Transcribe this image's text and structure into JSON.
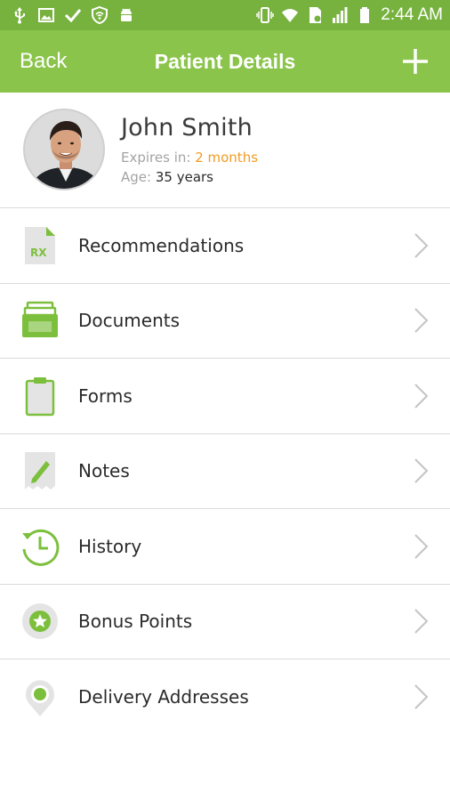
{
  "status_bar": {
    "time": "2:44 AM",
    "icons_left": [
      "usb-icon",
      "image-icon",
      "check-icon",
      "shield-wifi-icon",
      "android-icon"
    ],
    "icons_right": [
      "vibrate-icon",
      "wifi-icon",
      "sim-icon",
      "signal-icon",
      "battery-icon"
    ]
  },
  "appbar": {
    "back_label": "Back",
    "title": "Patient Details",
    "add_icon": "plus-icon"
  },
  "patient": {
    "name": "John Smith",
    "expires_label": "Expires in:",
    "expires_value": "2 months",
    "age_label": "Age:",
    "age_value": "35 years"
  },
  "menu": [
    {
      "label": "Recommendations",
      "icon": "rx-document-icon"
    },
    {
      "label": "Documents",
      "icon": "documents-stack-icon"
    },
    {
      "label": "Forms",
      "icon": "clipboard-icon"
    },
    {
      "label": "Notes",
      "icon": "pencil-note-icon"
    },
    {
      "label": "History",
      "icon": "history-clock-icon"
    },
    {
      "label": "Bonus Points",
      "icon": "star-badge-icon"
    },
    {
      "label": "Delivery Addresses",
      "icon": "location-pin-icon"
    }
  ],
  "colors": {
    "status_bar": "#77b23f",
    "app_bar": "#8ac44a",
    "accent_orange": "#f29b22",
    "icon_green": "#7cbf3c"
  }
}
